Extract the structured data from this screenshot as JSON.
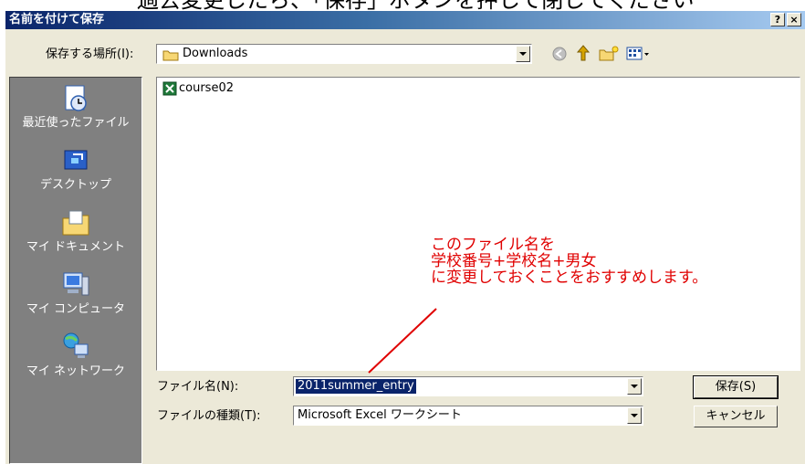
{
  "caption": "過去変更したら、「保存」ボタンを押して閉じてください",
  "dialog": {
    "title": "名前を付けて保存",
    "help_btn": "?",
    "close_btn": "×",
    "save_in_label": "保存する場所(I):",
    "save_in_value": "Downloads",
    "places": [
      {
        "label": "最近使ったファイル",
        "icon": "recent-documents-icon"
      },
      {
        "label": "デスクトップ",
        "icon": "desktop-icon"
      },
      {
        "label": "マイ ドキュメント",
        "icon": "my-documents-icon"
      },
      {
        "label": "マイ コンピュータ",
        "icon": "my-computer-icon"
      },
      {
        "label": "マイ ネットワーク",
        "icon": "my-network-icon"
      }
    ],
    "files": [
      {
        "name": "course02",
        "icon": "excel-file-icon"
      }
    ],
    "filename_label": "ファイル名(N):",
    "filename_value": "2011summer_entry",
    "filetype_label": "ファイルの種類(T):",
    "filetype_value": "Microsoft Excel ワークシート",
    "save_button": "保存(S)",
    "cancel_button": "キャンセル"
  },
  "annotation": {
    "line1": "このファイル名を",
    "line2": "学校番号+学校名+男女",
    "line3": "に変更しておくことをおすすめします。",
    "color": "#e00000"
  }
}
